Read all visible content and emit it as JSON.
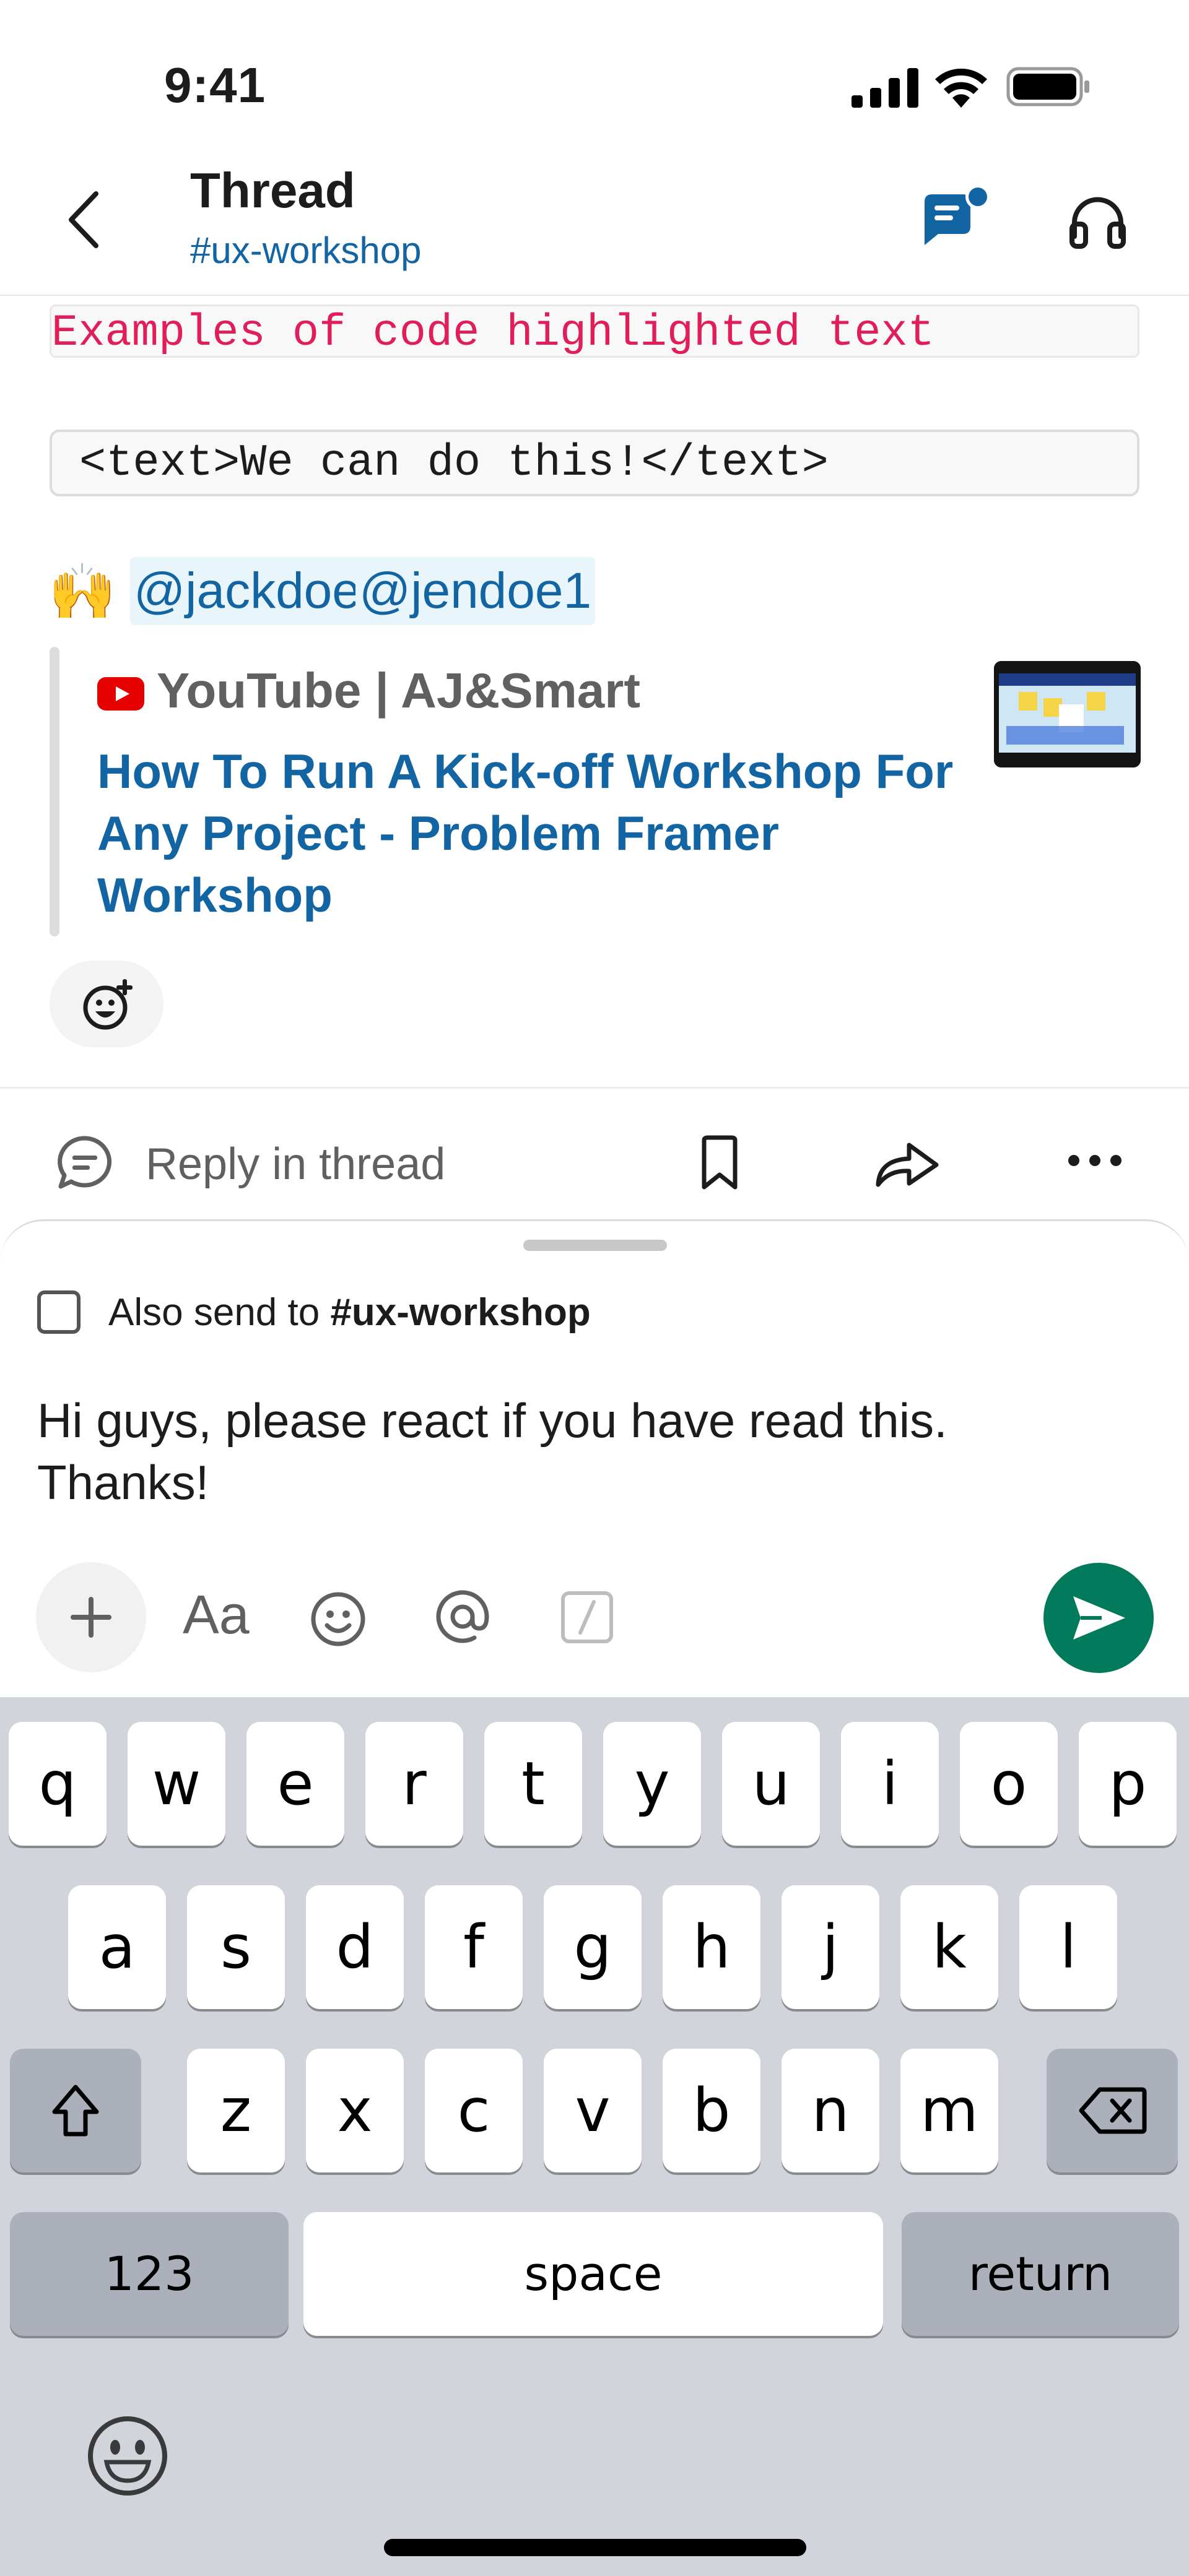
{
  "status_bar": {
    "time": "9:41"
  },
  "header": {
    "title": "Thread",
    "channel": "#ux-workshop"
  },
  "message": {
    "inline_code": "Examples of code highlighted text",
    "code_block": "<text>We can do this!</text>",
    "emoji": "🙌",
    "mentions": [
      "@jackdoe",
      "@jendoe1"
    ],
    "unfurl": {
      "source": "YouTube | AJ&Smart",
      "title_lines": [
        "How To Run A Kick-off Workshop For",
        "Any Project - Problem Framer",
        "Workshop"
      ]
    }
  },
  "actions": {
    "reply_label": "Reply in thread"
  },
  "composer": {
    "also_send_prefix": "Also send to ",
    "also_send_channel": "#ux-workshop",
    "also_send_checked": false,
    "text_lines": [
      "Hi guys, please react if you have read this.",
      "Thanks!"
    ],
    "format_label": "Aa"
  },
  "keyboard": {
    "row1": [
      "q",
      "w",
      "e",
      "r",
      "t",
      "y",
      "u",
      "i",
      "o",
      "p"
    ],
    "row2": [
      "a",
      "s",
      "d",
      "f",
      "g",
      "h",
      "j",
      "k",
      "l"
    ],
    "row3": [
      "z",
      "x",
      "c",
      "v",
      "b",
      "n",
      "m"
    ],
    "numbers_label": "123",
    "space_label": "space",
    "return_label": "return"
  },
  "colors": {
    "link": "#1264a3",
    "code_pink": "#e01e5a",
    "send_green": "#007a5a",
    "keyboard_bg": "#d1d4db"
  }
}
